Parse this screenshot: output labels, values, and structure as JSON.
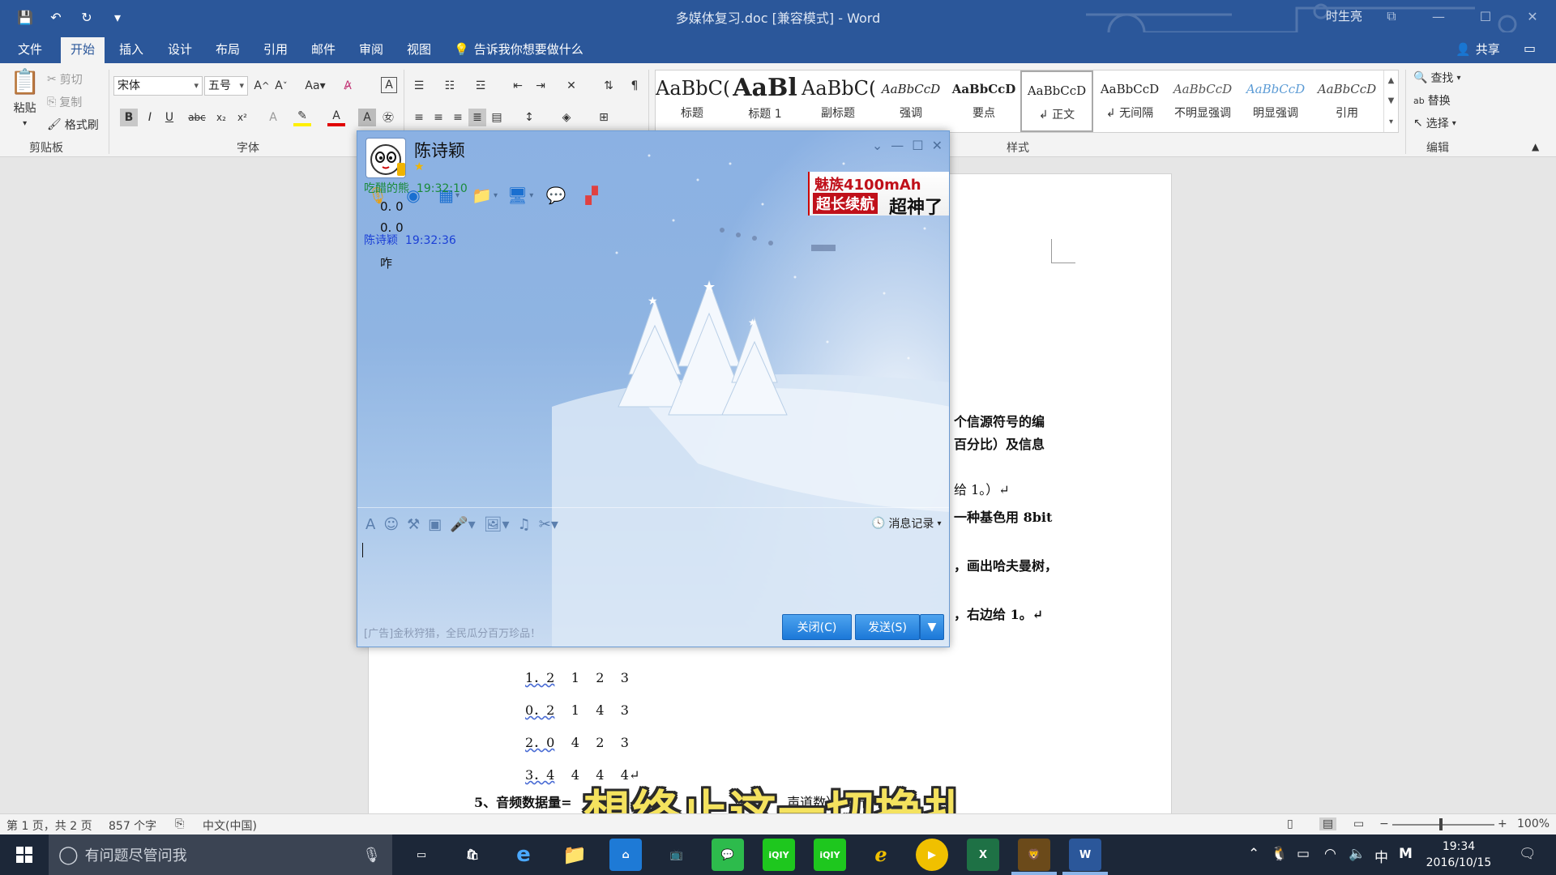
{
  "window": {
    "doc_title": "多媒体复习.doc [兼容模式] - Word",
    "user_name": "时生亮"
  },
  "tabs": [
    "文件",
    "开始",
    "插入",
    "设计",
    "布局",
    "引用",
    "邮件",
    "审阅",
    "视图"
  ],
  "active_tab": "开始",
  "tell_me": "告诉我你想要做什么",
  "share": "共享",
  "ribbon": {
    "clipboard": {
      "paste": "粘贴",
      "cut": "剪切",
      "copy": "复制",
      "format_painter": "格式刷",
      "label": "剪贴板"
    },
    "font": {
      "font_name": "宋体",
      "font_size": "五号",
      "label": "字体",
      "case_btn": "Aa"
    },
    "styles": {
      "label": "样式",
      "items": [
        {
          "preview": "AaBbC(",
          "name": "标题"
        },
        {
          "preview": "AaBl",
          "name": "标题 1"
        },
        {
          "preview": "AaBbC(",
          "name": "副标题"
        },
        {
          "preview": "AaBbCcD",
          "name": "强调"
        },
        {
          "preview": "AaBbCcD",
          "name": "要点"
        },
        {
          "preview": "AaBbCcD",
          "name": "↲ 正文"
        },
        {
          "preview": "AaBbCcD",
          "name": "↲ 无间隔"
        },
        {
          "preview": "AaBbCcD",
          "name": "不明显强调"
        },
        {
          "preview": "AaBbCcD",
          "name": "明显强调"
        },
        {
          "preview": "AaBbCcD",
          "name": "引用"
        }
      ]
    },
    "editing": {
      "find": "查找",
      "replace": "替换",
      "select": "选择",
      "label": "编辑"
    }
  },
  "document": {
    "lines": [
      {
        "text": "个信源符号的编",
        "bold": true
      },
      {
        "text": "百分比）及信息",
        "bold": true
      },
      {
        "text": "给 1。）↵",
        "bold": false
      },
      {
        "text": "一种基色用 8bit",
        "bold": true
      },
      {
        "text": "，画出哈夫曼树，",
        "bold": true
      },
      {
        "text": "，右边给 1。↵",
        "bold": true
      }
    ],
    "table_rows": [
      {
        "a": "1．2",
        "b": "1",
        "c": "2",
        "d": "3"
      },
      {
        "a": "0．2",
        "b": "1",
        "c": "4",
        "d": "3"
      },
      {
        "a": "2．0",
        "b": "4",
        "c": "2",
        "d": "3"
      },
      {
        "a": "3．4",
        "b": "4",
        "c": "4",
        "d": "4↵"
      }
    ],
    "last_line": "5、音频数据量=",
    "last_line_tail": "声道数）（字节/秒）"
  },
  "subtitle": "想终止这一切挣扎",
  "statusbar": {
    "page": "第 1 页，共 2 页",
    "words": "857 个字",
    "lang": "中文(中国)",
    "zoom": "100%"
  },
  "qq": {
    "contact": "陈诗颖",
    "ad_l1": "魅族4100mAh",
    "ad_l2": "超长续航",
    "ad_l3": "超神了",
    "messages": [
      {
        "sender": "吃醋的熊",
        "time": "19:32:10",
        "color": "#1a8a3a",
        "lines": [
          "0. 0",
          "0. 0"
        ]
      },
      {
        "sender": "陈诗颖",
        "time": "19:32:36",
        "color": "#1b3fd6",
        "lines": [
          "咋"
        ]
      }
    ],
    "history": "消息记录",
    "ad_text": "[广告]金秋狩猎，全民瓜分百万珍品！",
    "close_btn": "关闭(C)",
    "send_btn": "发送(S)"
  },
  "taskbar": {
    "search_placeholder": "有问题尽管问我",
    "apps": [
      "e",
      "Q",
      "iQIY",
      "iQIY",
      "X",
      "W"
    ],
    "ime": "中",
    "time": "19:34",
    "date": "2016/10/15"
  }
}
